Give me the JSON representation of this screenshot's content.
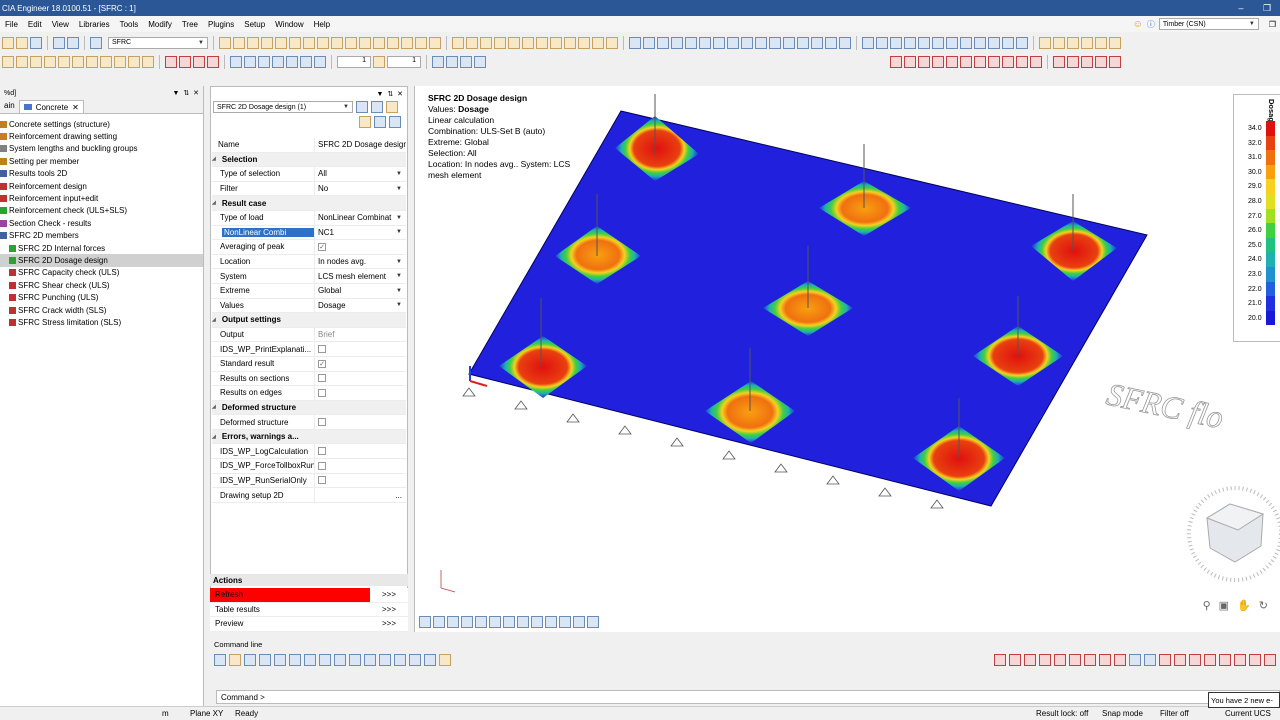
{
  "window": {
    "title": "CIA Engineer 18.0100.51 - [SFRC : 1]"
  },
  "menu": [
    "File",
    "Edit",
    "View",
    "Libraries",
    "Tools",
    "Modify",
    "Tree",
    "Plugins",
    "Setup",
    "Window",
    "Help"
  ],
  "material_combo": "Timber (CSN)",
  "toolbar": {
    "project_combo": "SFRC",
    "spin1": "1",
    "spin2": "1"
  },
  "left_pane": {
    "header": "%d]",
    "tab_main": "ain",
    "tab_concrete": "Concrete",
    "tree": [
      {
        "label": "Concrete settings (structure)",
        "indent": 0,
        "color": "#c08020"
      },
      {
        "label": "Reinforcement drawing setting",
        "indent": 0,
        "color": "#c08020"
      },
      {
        "label": "System lengths and buckling groups",
        "indent": 0,
        "color": "#808080"
      },
      {
        "label": "Setting per member",
        "indent": 0,
        "color": "#c08020"
      },
      {
        "label": "Results tools 2D",
        "indent": 0,
        "color": "#4060a0"
      },
      {
        "label": "Reinforcement design",
        "indent": 0,
        "color": "#c03030"
      },
      {
        "label": "Reinforcement input+edit",
        "indent": 0,
        "color": "#c03030"
      },
      {
        "label": "Reinforcement check (ULS+SLS)",
        "indent": 0,
        "color": "#30a030"
      },
      {
        "label": "Section Check - results",
        "indent": 0,
        "color": "#a040a0"
      },
      {
        "label": "SFRC 2D members",
        "indent": 0,
        "color": "#4060a0"
      },
      {
        "label": "SFRC 2D Internal forces",
        "indent": 1,
        "color": "#30a030"
      },
      {
        "label": "SFRC 2D Dosage design",
        "indent": 1,
        "color": "#30a030",
        "selected": true
      },
      {
        "label": "SFRC Capacity check (ULS)",
        "indent": 1,
        "color": "#c03030"
      },
      {
        "label": "SFRC Shear check (ULS)",
        "indent": 1,
        "color": "#c03030"
      },
      {
        "label": "SFRC Punching (ULS)",
        "indent": 1,
        "color": "#c03030"
      },
      {
        "label": "SFRC Crack width (SLS)",
        "indent": 1,
        "color": "#c03030"
      },
      {
        "label": "SFRC Stress limitation (SLS)",
        "indent": 1,
        "color": "#c03030"
      }
    ]
  },
  "properties": {
    "combo": "SFRC 2D Dosage design (1)",
    "name_label": "Name",
    "name_value": "SFRC 2D Dosage design",
    "rows": [
      {
        "type": "section",
        "label": "Selection"
      },
      {
        "type": "combo",
        "label": "Type of selection",
        "value": "All"
      },
      {
        "type": "combo",
        "label": "Filter",
        "value": "No"
      },
      {
        "type": "section",
        "label": "Result case"
      },
      {
        "type": "combo",
        "label": "Type of load",
        "value": "NonLinear Combinat"
      },
      {
        "type": "combo",
        "label": "NonLinear Combi",
        "value": "NC1",
        "highlight": true
      },
      {
        "type": "check",
        "label": "Averaging of peak",
        "checked": true
      },
      {
        "type": "combo",
        "label": "Location",
        "value": "In nodes avg."
      },
      {
        "type": "combo",
        "label": "System",
        "value": "LCS mesh element"
      },
      {
        "type": "combo",
        "label": "Extreme",
        "value": "Global"
      },
      {
        "type": "combo",
        "label": "Values",
        "value": "Dosage"
      },
      {
        "type": "section",
        "label": "Output settings"
      },
      {
        "type": "text",
        "label": "Output",
        "value": "Brief"
      },
      {
        "type": "check",
        "label": "IDS_WP_PrintExplanati...",
        "checked": false
      },
      {
        "type": "check",
        "label": "Standard result",
        "checked": true
      },
      {
        "type": "check",
        "label": "Results on sections",
        "checked": false
      },
      {
        "type": "check",
        "label": "Results on edges",
        "checked": false
      },
      {
        "type": "section",
        "label": "Deformed structure"
      },
      {
        "type": "check",
        "label": "Deformed structure",
        "checked": false
      },
      {
        "type": "section",
        "label": "Errors, warnings a..."
      },
      {
        "type": "check",
        "label": "IDS_WP_LogCalculation",
        "checked": false
      },
      {
        "type": "check",
        "label": "IDS_WP_ForceTollboxRun",
        "checked": false
      },
      {
        "type": "check",
        "label": "IDS_WP_RunSerialOnly",
        "checked": false
      },
      {
        "type": "button",
        "label": "Drawing setup 2D",
        "value": "..."
      }
    ]
  },
  "actions": {
    "title": "Actions",
    "items": [
      {
        "label": "Refresh",
        "go": ">>>",
        "highlight": true
      },
      {
        "label": "Table results",
        "go": ">>>"
      },
      {
        "label": "Preview",
        "go": ">>>"
      }
    ]
  },
  "viewport": {
    "info_title": "SFRC 2D Dosage design",
    "values_label": "Values: ",
    "values_value": "Dosage",
    "line2": "Linear calculation",
    "line3": "Combination: ULS-Set B (auto)",
    "line4": "Extreme: Global",
    "line5": "Selection: All",
    "line6": "Location: In nodes avg.. System: LCS",
    "line7": "mesh element",
    "watermark": "SFRC flo",
    "legend_title": "Dosage [kg/m³]",
    "legend": [
      {
        "label": "34.0",
        "color": "#e01010"
      },
      {
        "label": "32.0",
        "color": "#e84010"
      },
      {
        "label": "31.0",
        "color": "#f07010"
      },
      {
        "label": "30.0",
        "color": "#f8a010"
      },
      {
        "label": "29.0",
        "color": "#f8d020"
      },
      {
        "label": "28.0",
        "color": "#e0e020"
      },
      {
        "label": "27.0",
        "color": "#a0e020"
      },
      {
        "label": "26.0",
        "color": "#40d040"
      },
      {
        "label": "25.0",
        "color": "#20c080"
      },
      {
        "label": "24.0",
        "color": "#20b0b0"
      },
      {
        "label": "23.0",
        "color": "#2090d0"
      },
      {
        "label": "22.0",
        "color": "#2060e0"
      },
      {
        "label": "21.0",
        "color": "#2030e0"
      },
      {
        "label": "20.0",
        "color": "#1818d8"
      }
    ]
  },
  "command": {
    "title": "Command line",
    "prompt": "Command >"
  },
  "status": {
    "unit": "m",
    "plane": "Plane XY",
    "ready": "Ready",
    "result_lock": "Result lock: off",
    "snap": "Snap mode",
    "filter": "Filter off",
    "ucs": "Current UCS"
  },
  "notification": "You have 2 new e-"
}
